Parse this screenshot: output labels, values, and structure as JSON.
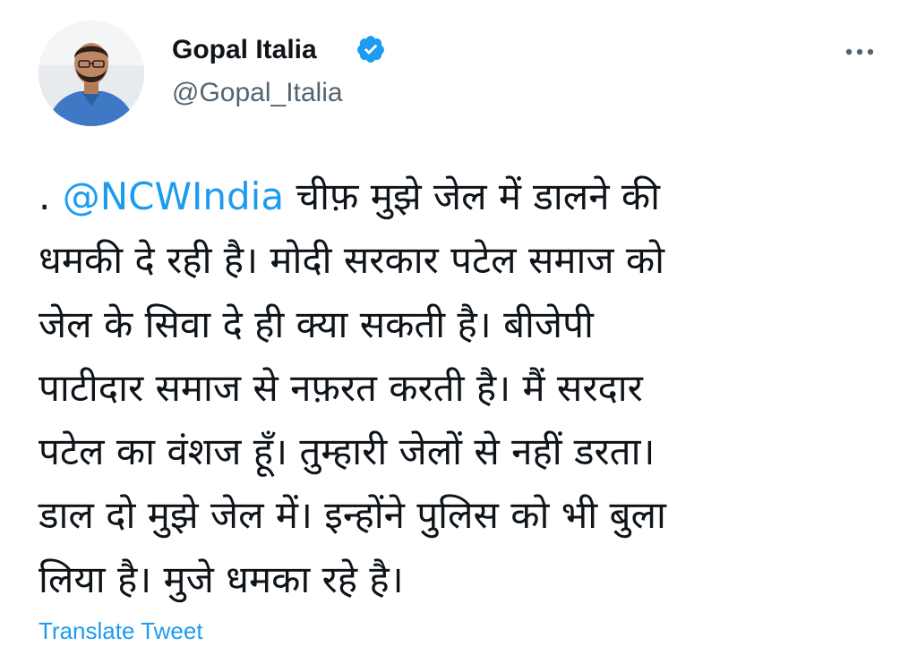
{
  "author": {
    "display_name": "Gopal Italia",
    "handle": "@Gopal_Italia",
    "verified": true,
    "avatar_icon": "profile-photo"
  },
  "more_icon": "ellipsis-icon",
  "tweet": {
    "prefix": ".",
    "mention": "@NCWIndia",
    "lines": [
      "चीफ़ मुझे जेल में डालने की",
      "धमकी दे रही है। मोदी सरकार पटेल समाज को",
      "जेल के सिवा दे ही क्या सकती है। बीजेपी",
      "पाटीदार समाज से नफ़रत करती है। मैं सरदार",
      "पटेल का वंशज हूँ। तुम्हारी जेलों से नहीं डरता।",
      "डाल दो मुझे जेल में। इन्होंने पुलिस को भी बुला",
      "लिया है। मुजे धमका रहे है।"
    ]
  },
  "translate_label": "Translate Tweet",
  "colors": {
    "accent": "#1d9bf0",
    "text": "#0f1419",
    "secondary": "#536471",
    "background": "#ffffff"
  }
}
